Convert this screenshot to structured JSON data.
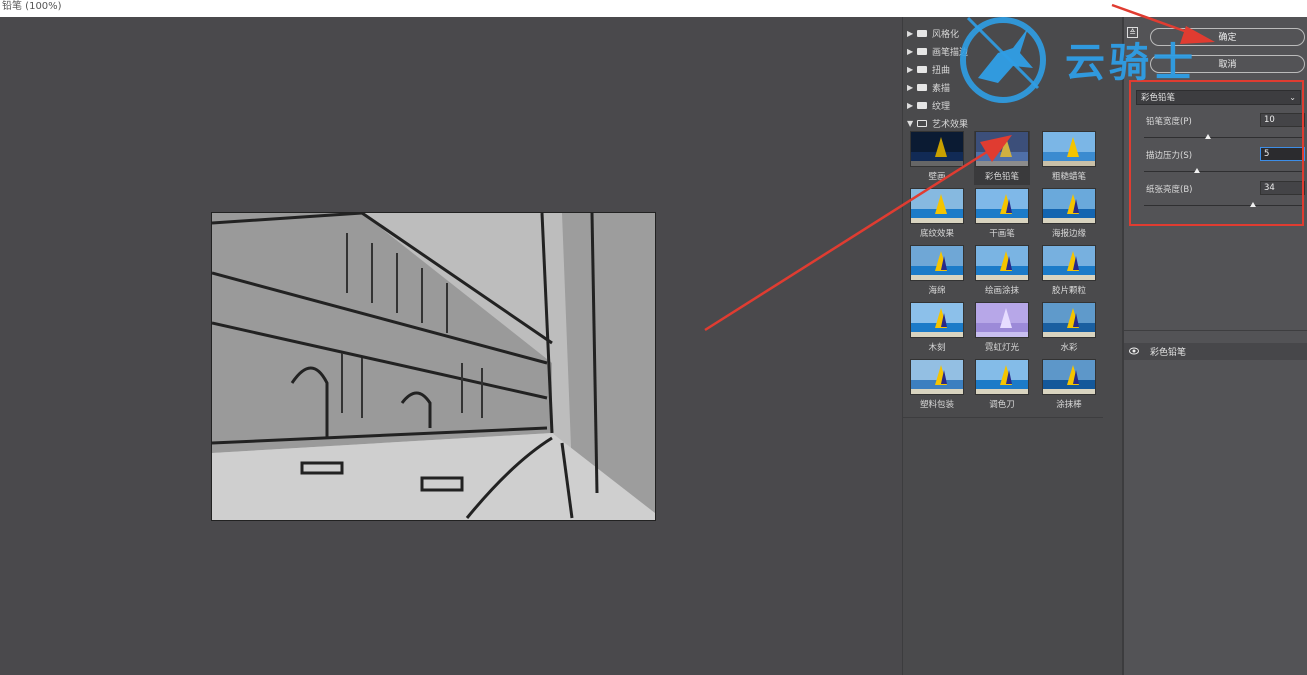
{
  "window": {
    "title": "铅笔 (100%)"
  },
  "browser": {
    "folders": [
      {
        "label": "风格化",
        "expanded": false
      },
      {
        "label": "画笔描边",
        "expanded": false
      },
      {
        "label": "扭曲",
        "expanded": false
      },
      {
        "label": "素描",
        "expanded": false
      },
      {
        "label": "纹理",
        "expanded": false
      },
      {
        "label": "艺术效果",
        "expanded": true
      }
    ],
    "filters": [
      "壁画",
      "彩色铅笔",
      "粗糙蜡笔",
      "底纹效果",
      "干画笔",
      "海报边缘",
      "海绵",
      "绘画涂抹",
      "胶片颗粒",
      "木刻",
      "霓虹灯光",
      "水彩",
      "塑料包装",
      "调色刀",
      "涂抹棒"
    ],
    "selected_filter": "彩色铅笔"
  },
  "settings": {
    "ok_label": "确定",
    "cancel_label": "取消",
    "filter_select": "彩色铅笔",
    "params": [
      {
        "label": "铅笔宽度(P)",
        "value": "10",
        "level": 0.4
      },
      {
        "label": "描边压力(S)",
        "value": "5",
        "level": 0.33
      },
      {
        "label": "纸张亮度(B)",
        "value": "34",
        "level": 0.68
      }
    ],
    "layer_label": "彩色铅笔"
  },
  "watermark": {
    "text": "云骑士"
  },
  "colors": {
    "highlight": "#e03c31",
    "watermark": "#2f9ee6",
    "input_focus": "#3d8ee8"
  }
}
